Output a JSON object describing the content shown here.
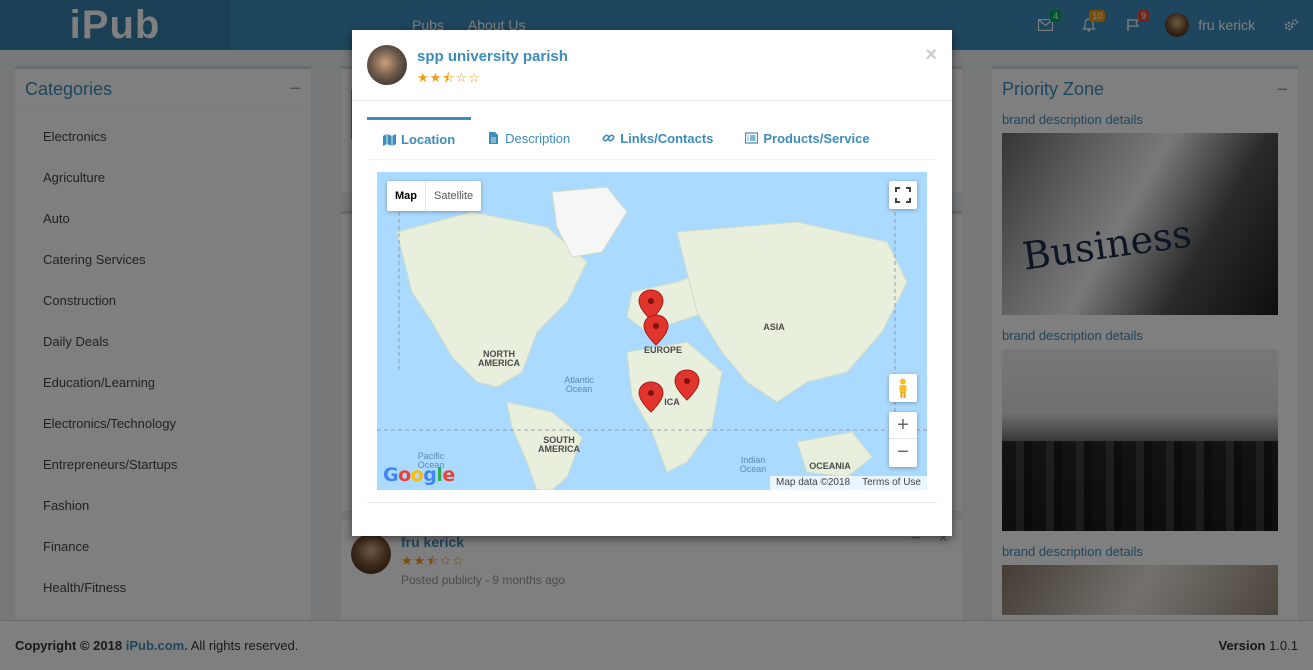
{
  "brand": "iPub",
  "nav": [
    "Pubs",
    "About Us"
  ],
  "notifications": {
    "mail": "4",
    "bell": "10",
    "flag": "9"
  },
  "user": {
    "name": "fru kerick"
  },
  "categories": {
    "title": "Categories",
    "items": [
      "Electronics",
      "Agriculture",
      "Auto",
      "Catering Services",
      "Construction",
      "Daily Deals",
      "Education/Learning",
      "Electronics/Technology",
      "Entrepreneurs/Startups",
      "Fashion",
      "Finance",
      "Health/Fitness"
    ]
  },
  "priority": {
    "title": "Priority Zone",
    "items": [
      {
        "link": "brand description details",
        "image_text": "Business"
      },
      {
        "link": "brand description details"
      },
      {
        "link": "brand description details"
      }
    ]
  },
  "post": {
    "name": "fru kerick",
    "stars": "★★⯪☆☆",
    "meta": "Posted publicly - 9 months ago"
  },
  "footer": {
    "copyright": "Copyright © 2018",
    "site": "iPub.com.",
    "rights": "All rights reserved.",
    "version_label": "Version",
    "version": "1.0.1"
  },
  "modal": {
    "title": "spp university parish",
    "stars": "★★⯪☆☆",
    "close": "×",
    "tabs": [
      {
        "label": "Location",
        "icon": "map-icon"
      },
      {
        "label": "Description",
        "icon": "file-icon"
      },
      {
        "label": "Links/Contacts",
        "icon": "link-icon"
      },
      {
        "label": "Products/Service",
        "icon": "list-icon"
      }
    ],
    "map": {
      "type_map": "Map",
      "type_satellite": "Satellite",
      "zoom_in": "+",
      "zoom_out": "−",
      "google": "Google",
      "attribution": "Map data ©2018",
      "terms": "Terms of Use",
      "labels": {
        "north_america": "NORTH AMERICA",
        "south_america": "SOUTH AMERICA",
        "europe": "EUROPE",
        "asia": "ASIA",
        "africa": "ICA",
        "oceania": "OCEANIA",
        "atlantic": "Atlantic Ocean",
        "pacific": "Pacific Ocean",
        "indian": "Indian Ocean"
      }
    }
  }
}
